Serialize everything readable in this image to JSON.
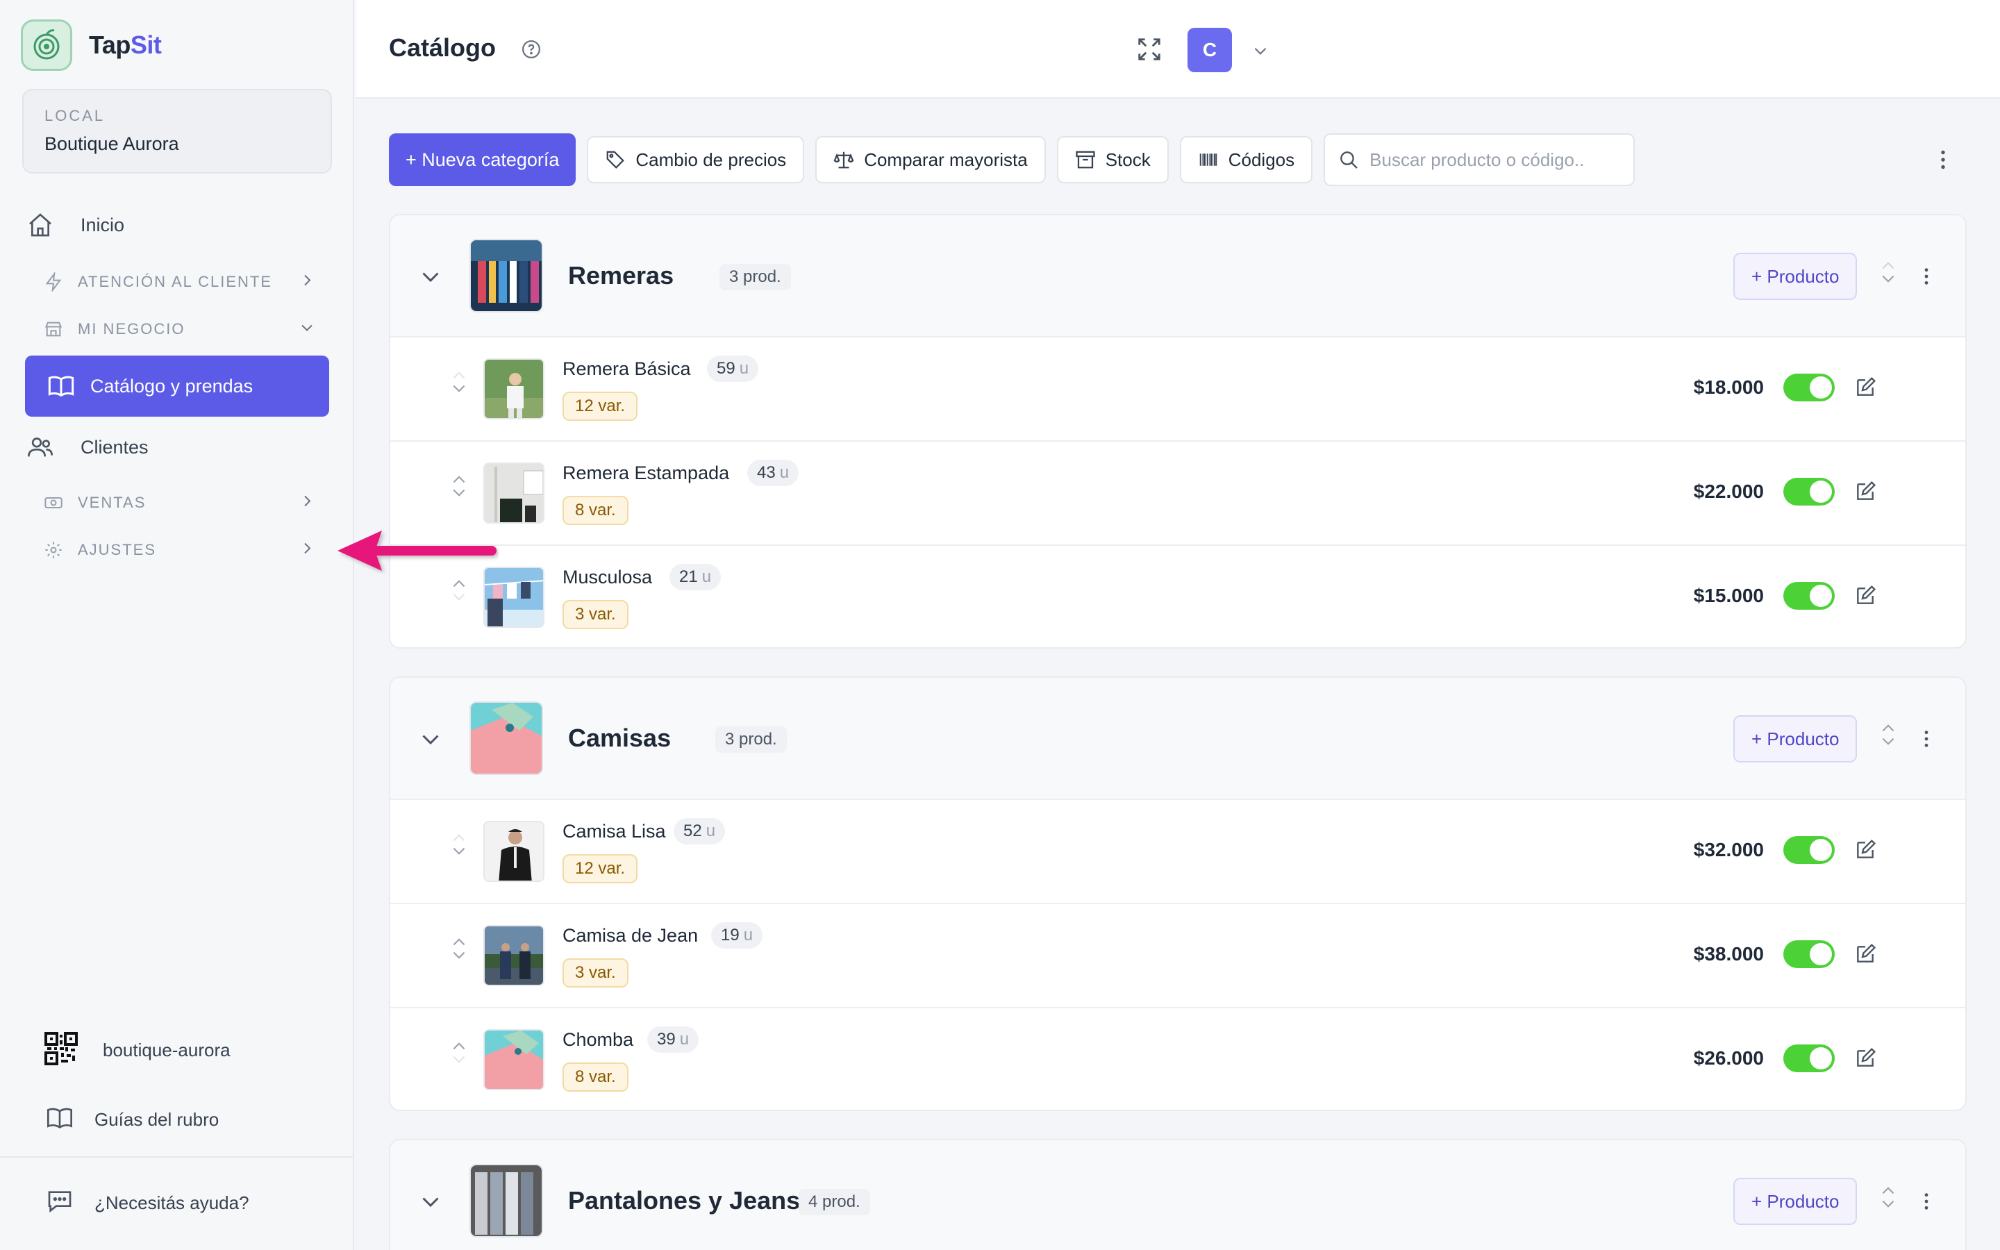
{
  "app": {
    "brand_prefix": "Tap",
    "brand_suffix": "Sit",
    "accent": "#5b5be8"
  },
  "sidebar": {
    "local_label": "LOCAL",
    "local_value": "Boutique Aurora",
    "items": [
      {
        "label": "Inicio",
        "icon": "home-icon"
      },
      {
        "label": "ATENCIÓN AL CLIENTE",
        "icon": "lightning-icon",
        "type": "section"
      },
      {
        "label": "MI NEGOCIO",
        "icon": "store-icon",
        "type": "section"
      },
      {
        "label": "Catálogo y prendas",
        "icon": "book-icon",
        "active": true
      },
      {
        "label": "Clientes",
        "icon": "users-icon"
      },
      {
        "label": "VENTAS",
        "icon": "cash-icon",
        "type": "section"
      },
      {
        "label": "AJUSTES",
        "icon": "gear-icon",
        "type": "section"
      }
    ],
    "qr_label": "boutique-aurora",
    "guides_label": "Guías del rubro",
    "help_label": "¿Necesitás ayuda?"
  },
  "header": {
    "title": "Catálogo",
    "avatar_letter": "C"
  },
  "toolbar": {
    "new_category": "+ Nueva categoría",
    "price_change": "Cambio de precios",
    "compare": "Comparar mayorista",
    "stock": "Stock",
    "codes": "Códigos",
    "search_placeholder": "Buscar producto o código.."
  },
  "categories": [
    {
      "name": "Remeras",
      "count": "3 prod.",
      "add_label": "+ Producto",
      "products": [
        {
          "name": "Remera Básica",
          "stock": "59",
          "unit": "u",
          "variants": "12 var.",
          "price": "$18.000",
          "active": true
        },
        {
          "name": "Remera Estampada",
          "stock": "43",
          "unit": "u",
          "variants": "8 var.",
          "price": "$22.000",
          "active": true
        },
        {
          "name": "Musculosa",
          "stock": "21",
          "unit": "u",
          "variants": "3 var.",
          "price": "$15.000",
          "active": true
        }
      ]
    },
    {
      "name": "Camisas",
      "count": "3 prod.",
      "add_label": "+ Producto",
      "products": [
        {
          "name": "Camisa Lisa",
          "stock": "52",
          "unit": "u",
          "variants": "12 var.",
          "price": "$32.000",
          "active": true
        },
        {
          "name": "Camisa de Jean",
          "stock": "19",
          "unit": "u",
          "variants": "3 var.",
          "price": "$38.000",
          "active": true
        },
        {
          "name": "Chomba",
          "stock": "39",
          "unit": "u",
          "variants": "8 var.",
          "price": "$26.000",
          "active": true
        }
      ]
    },
    {
      "name": "Pantalones y Jeans",
      "count": "4 prod.",
      "add_label": "+ Producto",
      "products": []
    }
  ]
}
